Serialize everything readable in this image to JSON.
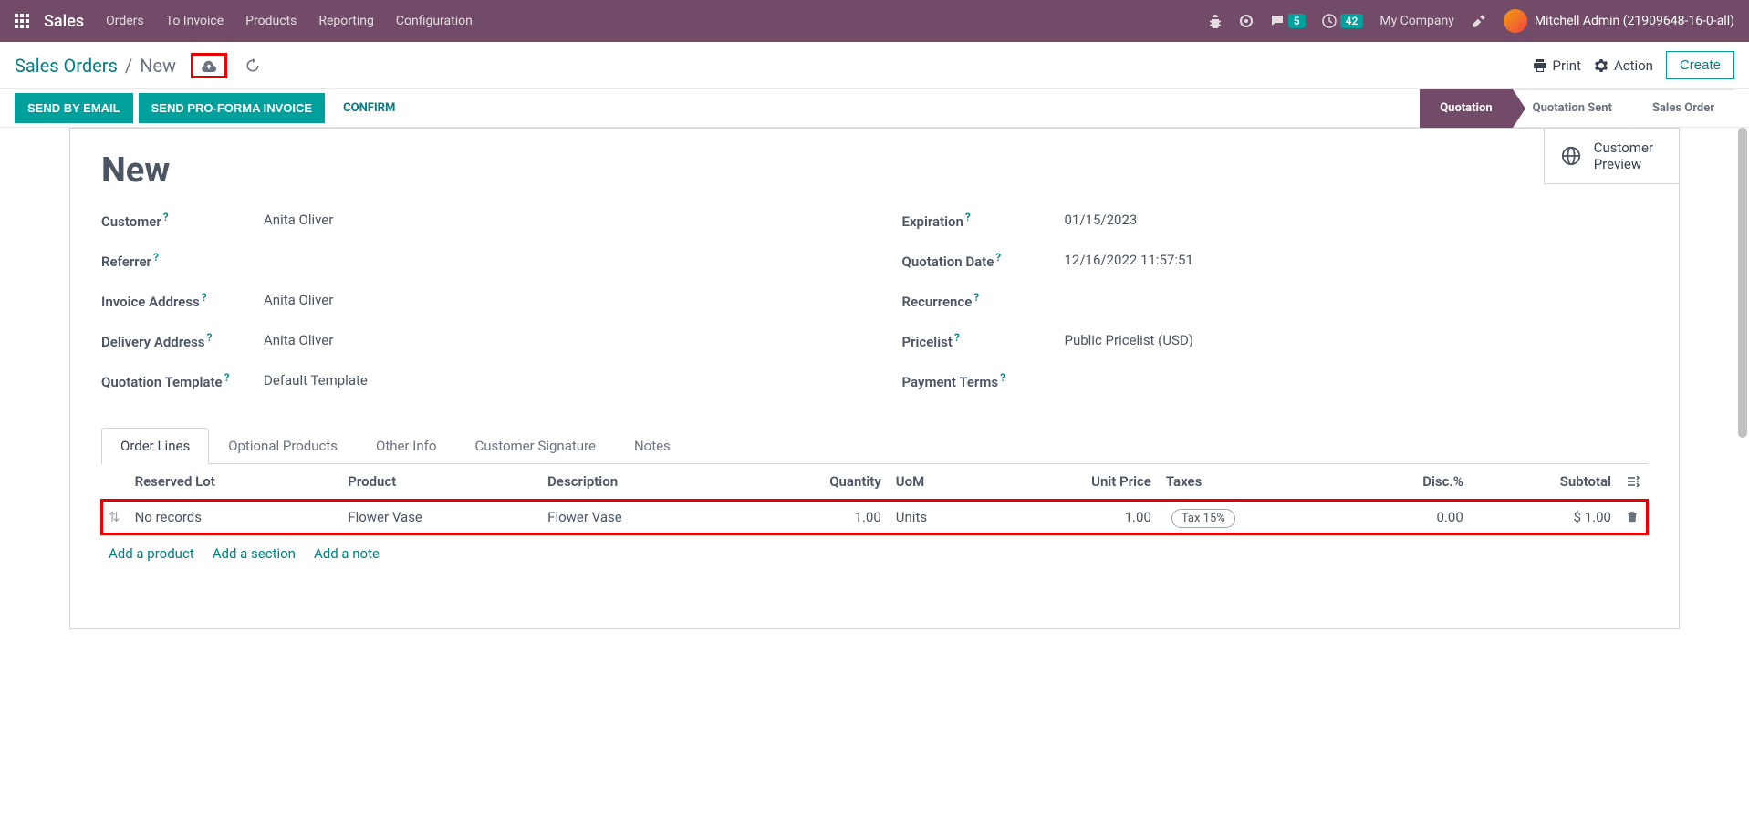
{
  "navbar": {
    "brand": "Sales",
    "menu": [
      "Orders",
      "To Invoice",
      "Products",
      "Reporting",
      "Configuration"
    ],
    "messages_badge": "5",
    "activities_badge": "42",
    "company": "My Company",
    "user": "Mitchell Admin (21909648-16-0-all)"
  },
  "breadcrumb": {
    "root": "Sales Orders",
    "separator": "/",
    "current": "New",
    "print": "Print",
    "action": "Action",
    "create": "Create"
  },
  "actions": {
    "send_email": "Send by Email",
    "send_proforma": "Send PRO-FORMA Invoice",
    "confirm": "Confirm"
  },
  "status": {
    "quotation": "Quotation",
    "quotation_sent": "Quotation Sent",
    "sales_order": "Sales Order"
  },
  "preview": {
    "line1": "Customer",
    "line2": "Preview"
  },
  "form": {
    "title": "New",
    "labels": {
      "customer": "Customer",
      "referrer": "Referrer",
      "invoice_address": "Invoice Address",
      "delivery_address": "Delivery Address",
      "quotation_template": "Quotation Template",
      "expiration": "Expiration",
      "quotation_date": "Quotation Date",
      "recurrence": "Recurrence",
      "pricelist": "Pricelist",
      "payment_terms": "Payment Terms"
    },
    "values": {
      "customer": "Anita Oliver",
      "invoice_address": "Anita Oliver",
      "delivery_address": "Anita Oliver",
      "quotation_template": "Default Template",
      "expiration": "01/15/2023",
      "quotation_date": "12/16/2022 11:57:51",
      "pricelist": "Public Pricelist (USD)"
    }
  },
  "tabs": [
    "Order Lines",
    "Optional Products",
    "Other Info",
    "Customer Signature",
    "Notes"
  ],
  "table": {
    "headers": {
      "reserved_lot": "Reserved Lot",
      "product": "Product",
      "description": "Description",
      "quantity": "Quantity",
      "uom": "UoM",
      "unit_price": "Unit Price",
      "taxes": "Taxes",
      "disc": "Disc.%",
      "subtotal": "Subtotal"
    },
    "rows": [
      {
        "reserved_lot": "No records",
        "product": "Flower Vase",
        "description": "Flower Vase",
        "quantity": "1.00",
        "uom": "Units",
        "unit_price": "1.00",
        "tax": "Tax 15%",
        "disc": "0.00",
        "subtotal": "$ 1.00"
      }
    ],
    "add_product": "Add a product",
    "add_section": "Add a section",
    "add_note": "Add a note"
  }
}
